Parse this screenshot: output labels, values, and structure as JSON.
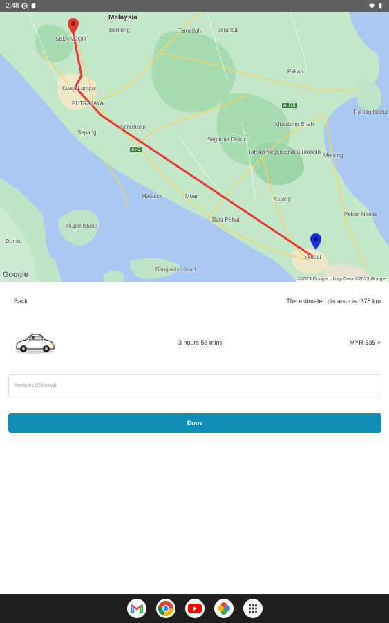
{
  "status_bar": {
    "time": "2:48",
    "icons": [
      "wifi-icon",
      "battery-icon"
    ]
  },
  "map": {
    "labels": {
      "country": "Malaysia",
      "selangor": "SELANGOR",
      "kuala_lumpur": "Kuala Lumpur",
      "putrajaya": "PUTRAJAYA",
      "sepang": "Sepang",
      "seremban": "Seremban",
      "malacca": "Malacca",
      "muar": "Muar",
      "batu_pahat": "Batu Pahat",
      "kluang": "Kluang",
      "endau": "Taman Negeri Endau Rompin",
      "segamat": "Segamat District",
      "mersing": "Mersing",
      "skudai": "Skudai",
      "kuantan": "Pekan",
      "temerloh": "Temerloh",
      "jerantut": "Jerantut",
      "bentong": "Bentong",
      "tioman": "Tioman Island",
      "pekan_nanas": "Pekan Nenas",
      "rupat": "Rupat Island",
      "dumai": "Dumai",
      "bengkalis": "Bengkalis Island",
      "highway_ah2": "AH2",
      "highway_ah18": "AH18",
      "muadzam": "Muadzam Shah"
    },
    "google_logo": "Google",
    "attribution": "©2023 Google · Map Data ©2023 Google"
  },
  "sheet": {
    "back_label": "Back",
    "distance_text": "The estimated distance is: 378 km",
    "duration_text": "3 hours 53 mins",
    "price_text": "MYR 335 >",
    "remarks_placeholder": "Remarks (Optional)",
    "done_label": "Done",
    "colors": {
      "primary": "#0f8db5",
      "route": "#e53935"
    }
  },
  "nav_bar": {
    "apps": [
      "gmail-icon",
      "chrome-icon",
      "youtube-icon",
      "photos-icon",
      "app-drawer-icon"
    ]
  }
}
